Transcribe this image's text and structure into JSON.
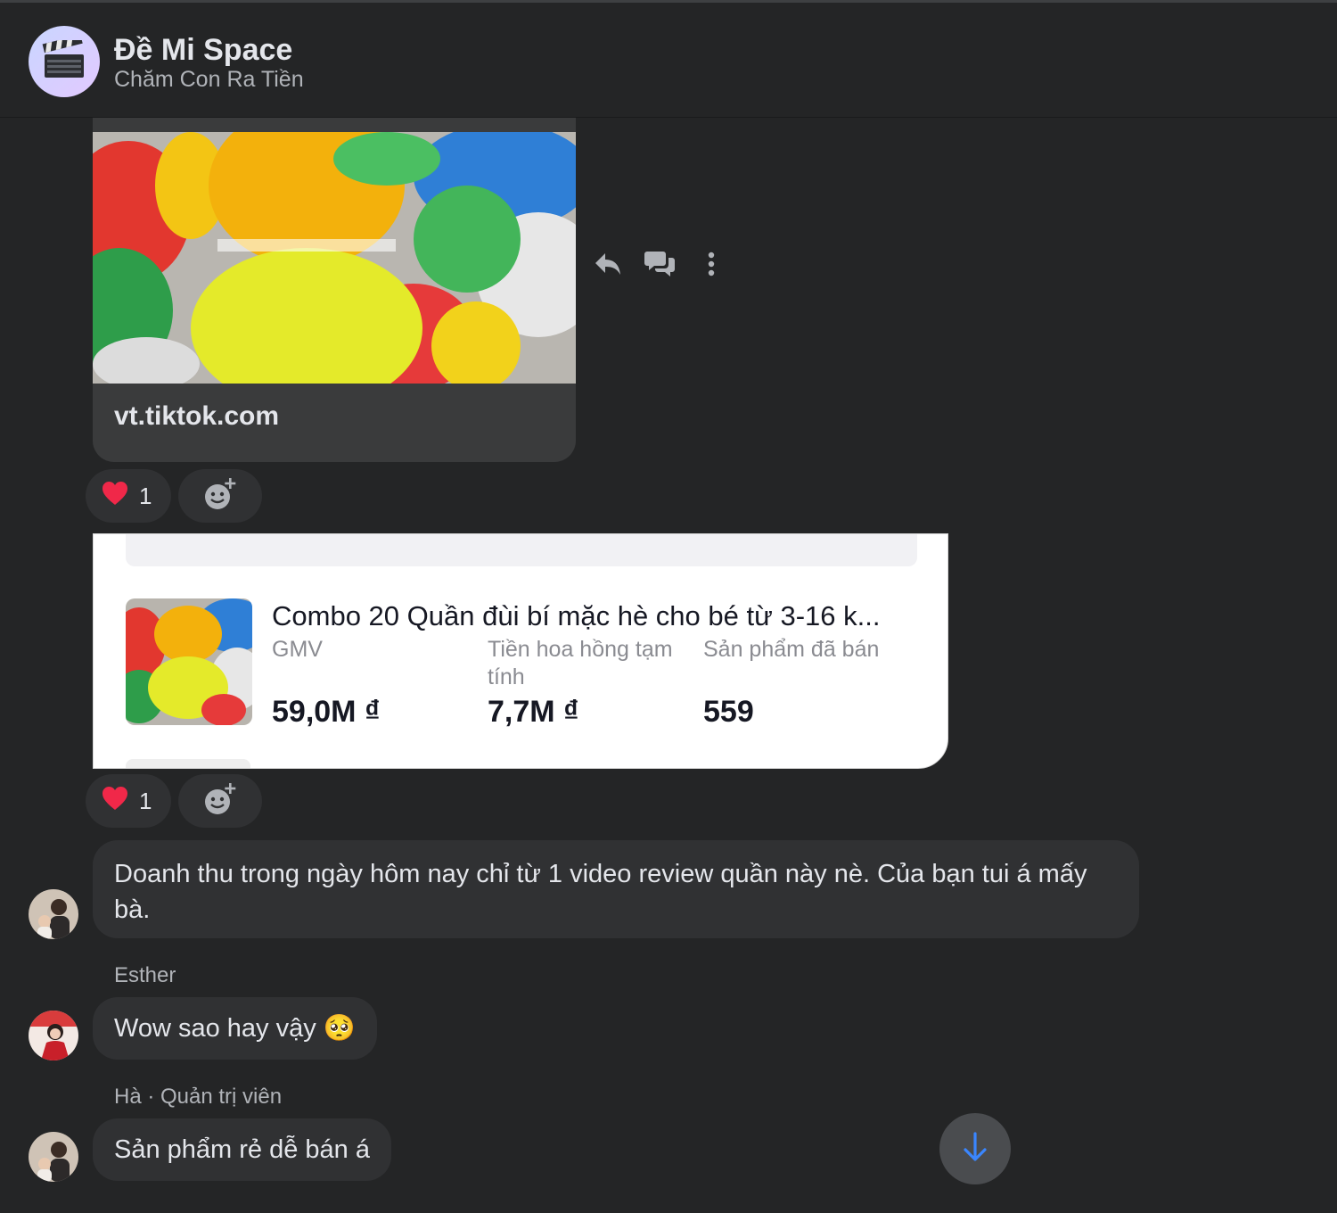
{
  "header": {
    "group_title": "Đề Mi Space",
    "group_subtitle": "Chăm Con Ra Tiền",
    "avatar_icon": "clapperboard-icon"
  },
  "link_preview": {
    "domain": "vt.tiktok.com"
  },
  "hover_actions": [
    "reply-icon",
    "reply-in-thread-icon",
    "more-icon"
  ],
  "reactions_1": {
    "emoji": "❤️",
    "count": "1"
  },
  "product_card": {
    "title": "Combo 20 Quần đùi bí mặc hè cho bé từ 3-16 k...",
    "metrics": [
      {
        "label": "GMV",
        "value": "59,0M ₫"
      },
      {
        "label": "Tiền hoa hồng tạm tính",
        "value": "7,7M ₫"
      },
      {
        "label": "Sản phẩm đã bán",
        "value": "559"
      }
    ]
  },
  "reactions_2": {
    "emoji": "❤️",
    "count": "1"
  },
  "messages": [
    {
      "sender": "",
      "text": "Doanh thu trong ngày hôm nay chỉ từ 1 video review quần này nè. Của bạn tui á mấy bà."
    },
    {
      "sender": "Esther",
      "text": "Wow sao hay vậy 🥺"
    },
    {
      "sender": "Hà · Quản trị viên",
      "text": "Sản phẩm rẻ dễ bán á"
    }
  ],
  "colors": {
    "background": "#242526",
    "bubble": "#303133",
    "accent": "#3a86ff",
    "heart": "#f02849"
  }
}
